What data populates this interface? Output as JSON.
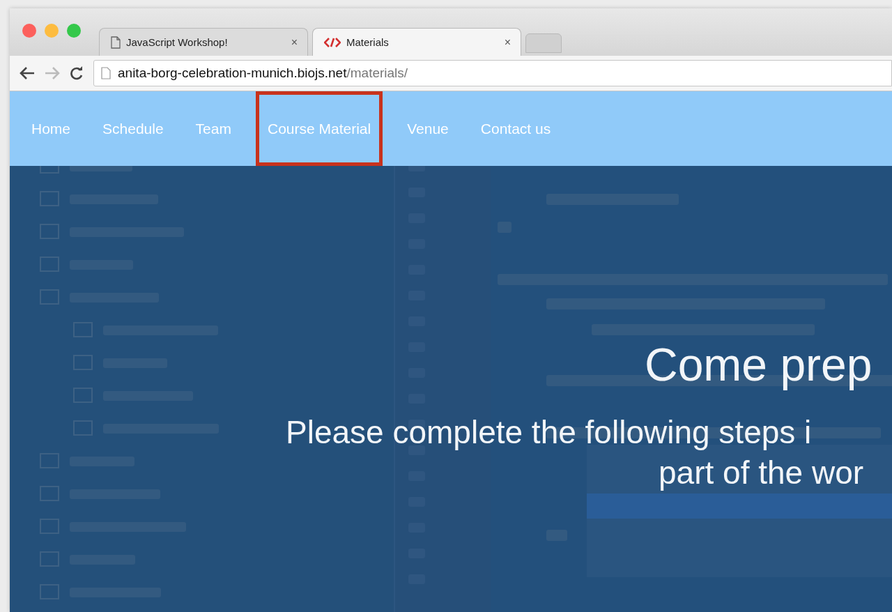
{
  "browser": {
    "tabs": [
      {
        "title": "JavaScript Workshop!",
        "kind": "document",
        "close": "×",
        "selected": false
      },
      {
        "title": "Materials",
        "kind": "logo",
        "close": "×",
        "selected": true
      }
    ],
    "url": {
      "host": "anita-borg-celebration-munich.biojs.net",
      "path": "/materials/"
    }
  },
  "nav": {
    "items": [
      {
        "label": "Home",
        "highlighted": false
      },
      {
        "label": "Schedule",
        "highlighted": false
      },
      {
        "label": "Team",
        "highlighted": false
      },
      {
        "label": "Course Material",
        "highlighted": true
      },
      {
        "label": "Venue",
        "highlighted": false
      },
      {
        "label": "Contact us",
        "highlighted": false
      }
    ]
  },
  "hero": {
    "headline": "Come prep",
    "lines": [
      "Please complete the following steps i",
      "part of the wor"
    ]
  }
}
